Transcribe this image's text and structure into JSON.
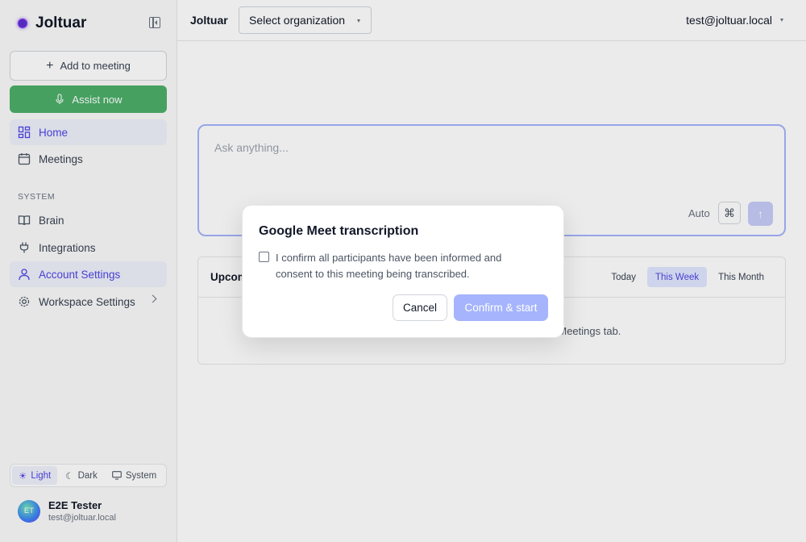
{
  "app": {
    "name": "Joltuar"
  },
  "sidebar": {
    "add_meeting": "Add to meeting",
    "assist_now": "Assist now",
    "nav": [
      {
        "label": "Home",
        "icon": "grid-icon"
      },
      {
        "label": "Meetings",
        "icon": "calendar-icon"
      }
    ],
    "system_label": "SYSTEM",
    "system_items": [
      {
        "label": "Brain",
        "icon": "book-icon"
      },
      {
        "label": "Integrations",
        "icon": "plug-icon"
      },
      {
        "label": "Account Settings",
        "icon": "user-icon"
      },
      {
        "label": "Workspace Settings",
        "icon": "gear-icon"
      }
    ],
    "theme": {
      "light": "Light",
      "dark": "Dark",
      "system": "System",
      "selected": "Light"
    },
    "user": {
      "initials": "ET",
      "name": "E2E Tester",
      "email": "test@joltuar.local"
    }
  },
  "header": {
    "title": "Joltuar",
    "org_select": "Select organization",
    "account": "test@joltuar.local"
  },
  "ask": {
    "placeholder": "Ask anything...",
    "mode": "Auto",
    "cmd_symbol": "⌘",
    "send_symbol": "↑"
  },
  "upcoming": {
    "title": "Upcoming",
    "tabs": [
      "Today",
      "This Week",
      "This Month"
    ],
    "active_tab": "This Week",
    "empty_text": "No upcoming meetings. Add one from the Meetings tab."
  },
  "modal": {
    "title": "Google Meet transcription",
    "consent": "I confirm all participants have been informed and consent to this meeting being transcribed.",
    "cancel": "Cancel",
    "confirm": "Confirm & start"
  },
  "colors": {
    "accent": "#4f46e5",
    "assist_green": "#4caf69",
    "confirm_disabled": "#a5b4fc"
  }
}
